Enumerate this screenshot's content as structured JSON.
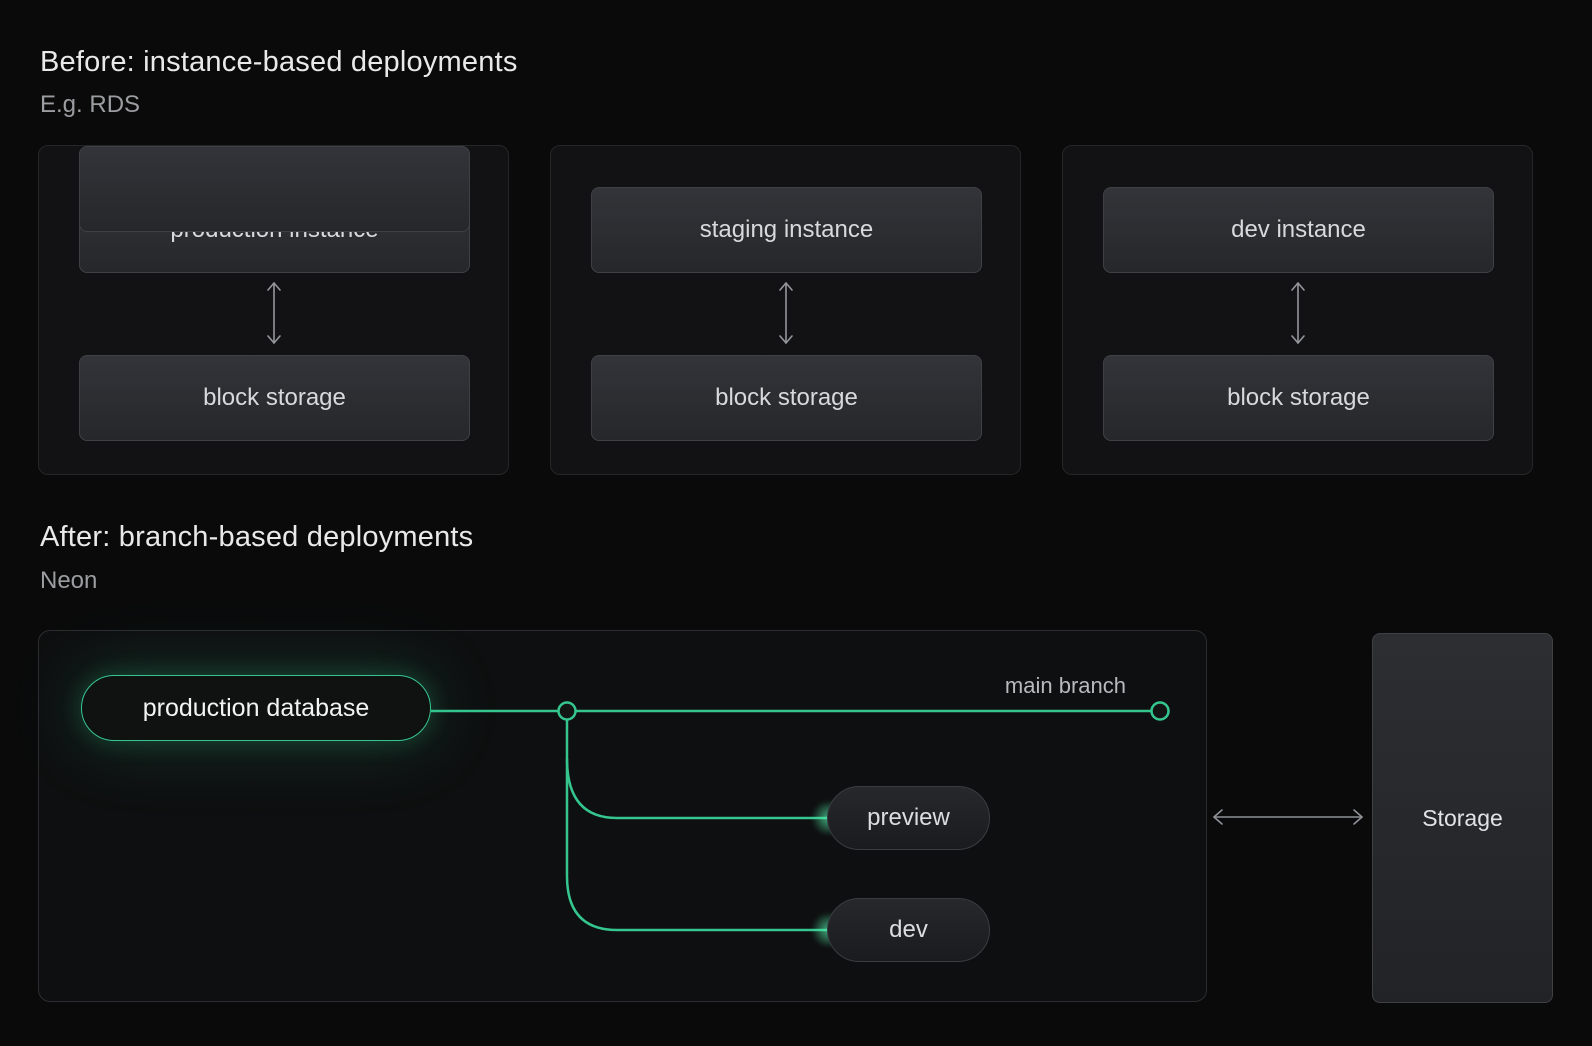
{
  "before": {
    "title": "Before: instance-based deployments",
    "subtitle": "E.g. RDS",
    "cards": [
      {
        "instance": "production instance",
        "storage": "block storage"
      },
      {
        "instance": "staging instance",
        "storage": "block storage"
      },
      {
        "instance": "dev instance",
        "storage": "block storage"
      }
    ]
  },
  "after": {
    "title": "After: branch-based deployments",
    "subtitle": "Neon",
    "production_db": "production database",
    "main_branch_label": "main branch",
    "branches": [
      {
        "label": "preview"
      },
      {
        "label": "dev"
      }
    ],
    "storage_label": "Storage"
  },
  "colors": {
    "background": "#0a0a0b",
    "accent_green": "#35c68f",
    "arrow_gray": "#8e9196",
    "card_border": "#2c2d30"
  }
}
